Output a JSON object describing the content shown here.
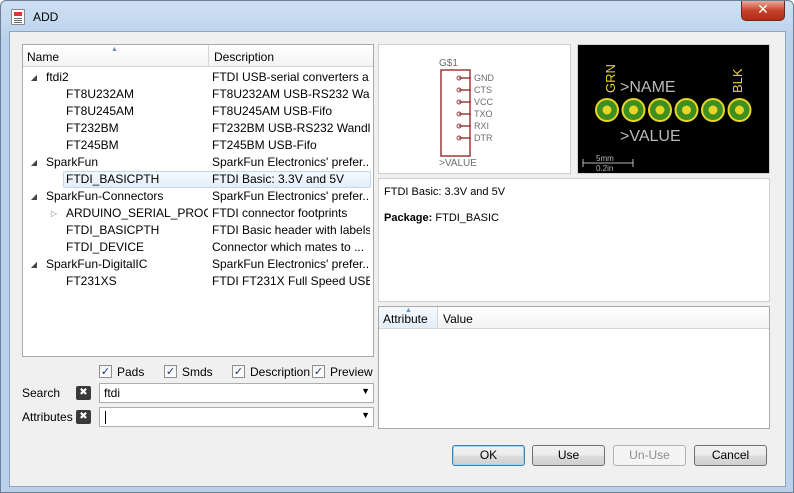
{
  "window": {
    "title": "ADD",
    "close_glyph": "✕"
  },
  "tree": {
    "columns": {
      "name": "Name",
      "description": "Description"
    },
    "rows": [
      {
        "level": 0,
        "expander": "open",
        "name": "ftdi2",
        "desc": "FTDI USB-serial converters a..."
      },
      {
        "level": 1,
        "expander": "none",
        "name": "FT8U232AM",
        "desc": "FT8U232AM USB-RS232 Wa..."
      },
      {
        "level": 1,
        "expander": "none",
        "name": "FT8U245AM",
        "desc": "FT8U245AM USB-Fifo"
      },
      {
        "level": 1,
        "expander": "none",
        "name": "FT232BM",
        "desc": "FT232BM USB-RS232 Wandler"
      },
      {
        "level": 1,
        "expander": "none",
        "name": "FT245BM",
        "desc": "FT245BM USB-Fifo"
      },
      {
        "level": 0,
        "expander": "open",
        "name": "SparkFun",
        "desc": "SparkFun Electronics' prefer..."
      },
      {
        "level": 1,
        "expander": "none",
        "name": "FTDI_BASICPTH",
        "desc": "FTDI Basic: 3.3V and 5V",
        "selected": true
      },
      {
        "level": 0,
        "expander": "open",
        "name": "SparkFun-Connectors",
        "desc": "SparkFun Electronics' prefer..."
      },
      {
        "level": 1,
        "expander": "closed",
        "name": "ARDUINO_SERIAL_PROG...",
        "desc": "FTDI connector footprints"
      },
      {
        "level": 1,
        "expander": "none",
        "name": "FTDI_BASICPTH",
        "desc": "FTDI Basic header with labels"
      },
      {
        "level": 1,
        "expander": "none",
        "name": "FTDI_DEVICE",
        "desc": "Connector which mates to ..."
      },
      {
        "level": 0,
        "expander": "open",
        "name": "SparkFun-DigitalIC",
        "desc": "SparkFun Electronics' prefer..."
      },
      {
        "level": 1,
        "expander": "none",
        "name": "FT231XS",
        "desc": "FTDI FT231X Full Speed USB..."
      }
    ]
  },
  "options": {
    "pads": {
      "label": "Pads",
      "checked": true
    },
    "smds": {
      "label": "Smds",
      "checked": true
    },
    "description": {
      "label": "Description",
      "checked": true
    },
    "preview": {
      "label": "Preview",
      "checked": true
    },
    "check_glyph": "✓"
  },
  "search": {
    "label": "Search",
    "value": "ftdi",
    "clear_glyph": "✖",
    "arrow_glyph": "▼"
  },
  "attributes_filter": {
    "label": "Attributes",
    "value": "",
    "clear_glyph": "✖",
    "arrow_glyph": "▼"
  },
  "symbol_preview": {
    "name": "G$1",
    "value": ">VALUE",
    "pins": [
      "GND",
      "CTS",
      "VCC",
      "TXO",
      "RXI",
      "DTR"
    ]
  },
  "package_preview": {
    "name_label": ">NAME",
    "value_label": ">VALUE",
    "left_label": "GRN",
    "right_label": "BLK",
    "scale_mm": "5mm",
    "scale_in": "0.2in",
    "pad_count": 6
  },
  "description": {
    "text": "FTDI Basic: 3.3V and 5V",
    "package_label": "Package:",
    "package_value": "FTDI_BASIC"
  },
  "attributes_table": {
    "columns": {
      "attribute": "Attribute",
      "value": "Value"
    }
  },
  "buttons": {
    "ok": "OK",
    "use": "Use",
    "unuse": "Un-Use",
    "cancel": "Cancel"
  },
  "colors": {
    "pkg_background": "#000000",
    "pkg_silk": "#e7d628",
    "pkg_pad": "#3e8f1f",
    "pkg_text": "#b9b9b9",
    "sym_body": "#9b3b3b",
    "sym_text": "#6d6d6d"
  }
}
